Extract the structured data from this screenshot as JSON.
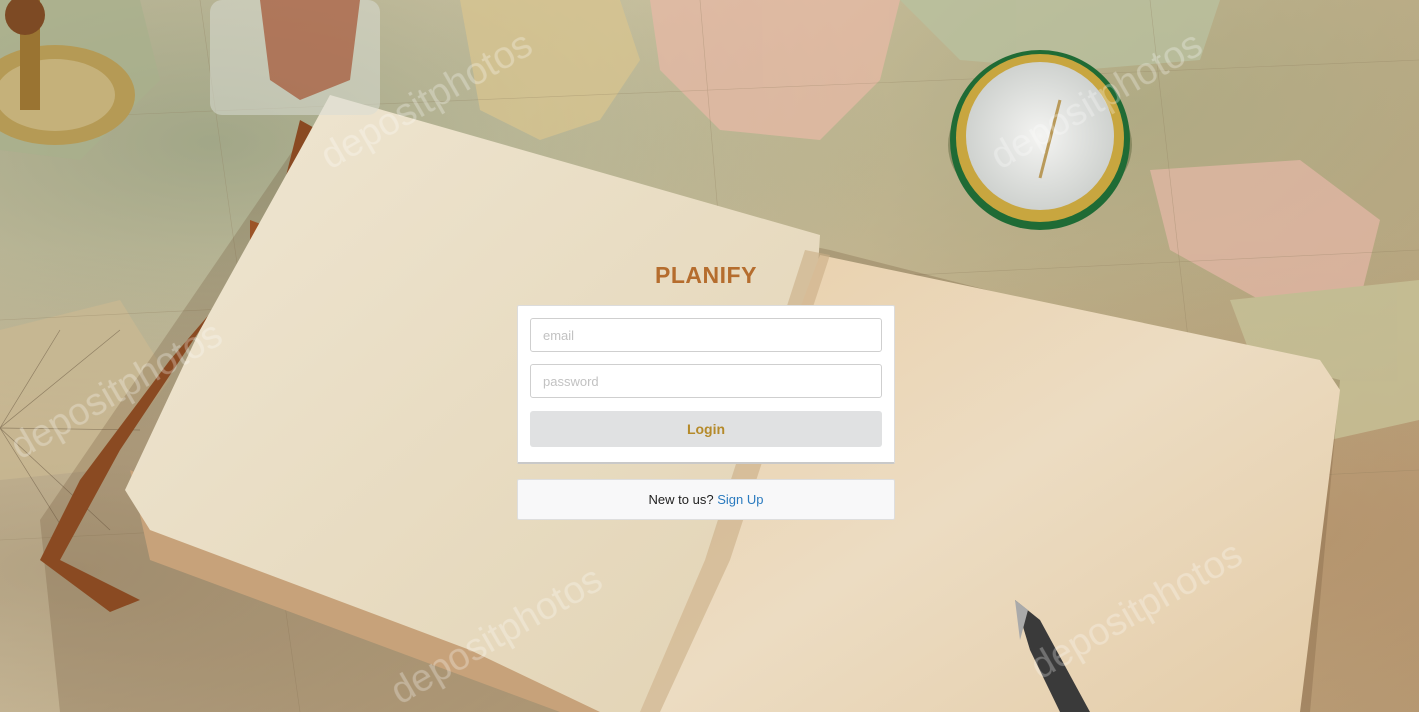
{
  "app": {
    "title": "PLANIFY"
  },
  "login_form": {
    "email_placeholder": "email",
    "password_placeholder": "password",
    "login_label": "Login"
  },
  "signup": {
    "prompt": "New to us?",
    "link_label": "Sign Up"
  },
  "colors": {
    "title": "#b56d2e",
    "login_text": "#b58a2a",
    "login_bg": "#e0e1e2",
    "link": "#2b7bbf"
  },
  "background": {
    "watermark_text": "depositphotos"
  }
}
